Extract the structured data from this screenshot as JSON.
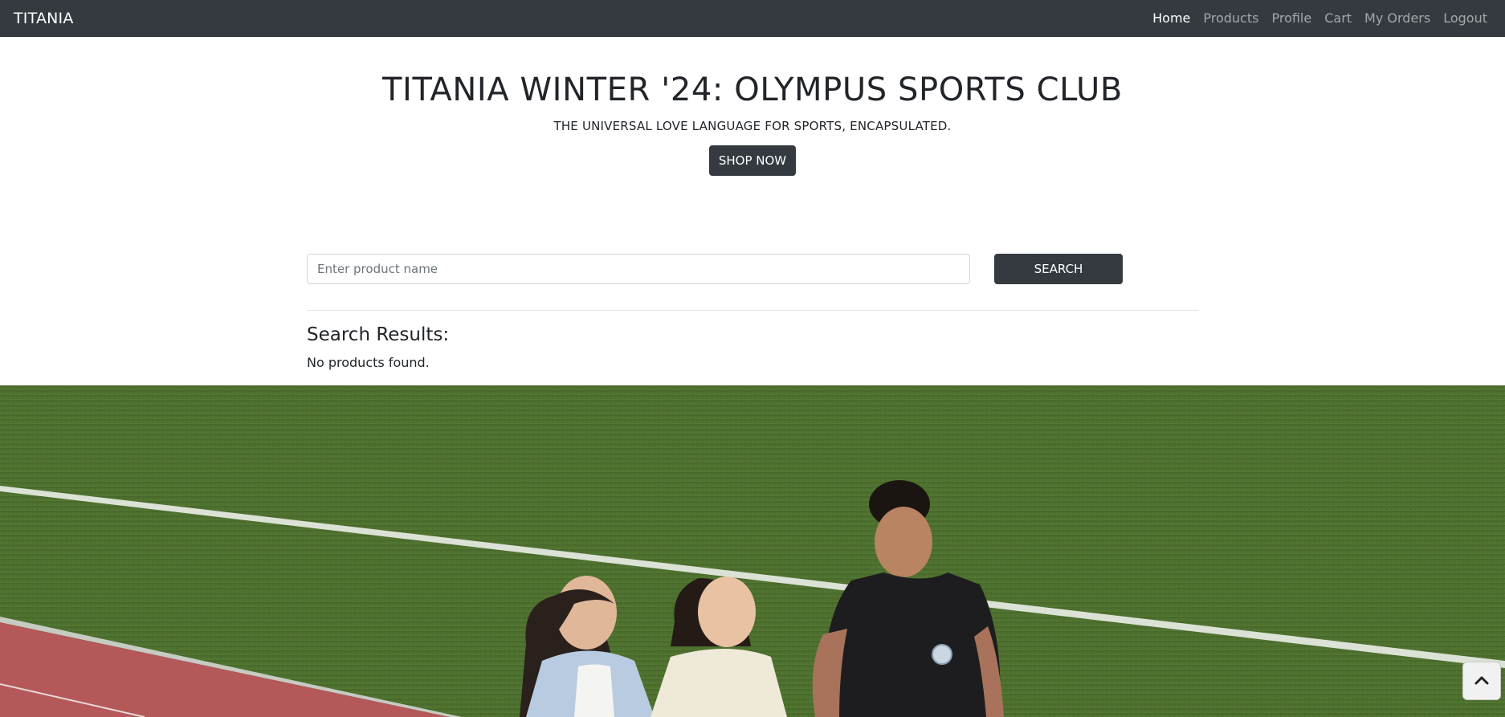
{
  "navbar": {
    "brand": "TITANIA",
    "links": [
      {
        "label": "Home",
        "active": true
      },
      {
        "label": "Products",
        "active": false
      },
      {
        "label": "Profile",
        "active": false
      },
      {
        "label": "Cart",
        "active": false
      },
      {
        "label": "My Orders",
        "active": false
      },
      {
        "label": "Logout",
        "active": false
      }
    ]
  },
  "hero": {
    "title": "TITANIA WINTER '24: OLYMPUS SPORTS CLUB",
    "subtitle": "THE UNIVERSAL LOVE LANGUAGE FOR SPORTS, ENCAPSULATED.",
    "cta_label": "SHOP NOW"
  },
  "search": {
    "placeholder": "Enter product name",
    "value": "",
    "button_label": "SEARCH"
  },
  "results": {
    "heading": "Search Results:",
    "empty_message": "No products found."
  },
  "banner": {
    "icon": "photo-image"
  },
  "back_to_top": {
    "icon": "chevron-up-icon"
  },
  "colors": {
    "navbar_bg": "#343a40",
    "button_bg": "#343a40",
    "grass": "#4b6a2c",
    "track": "#b4585a"
  }
}
